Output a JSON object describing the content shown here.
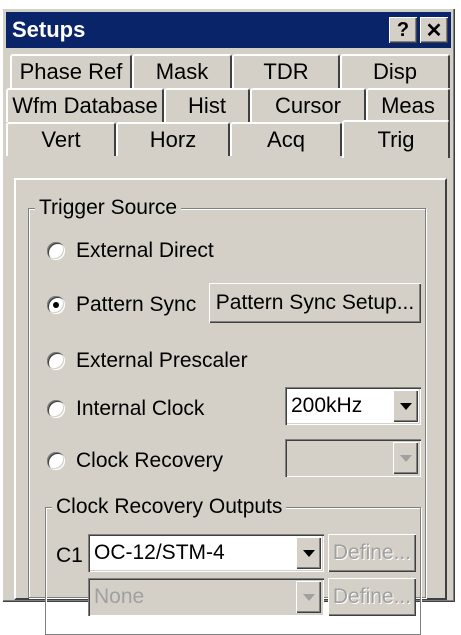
{
  "window": {
    "title": "Setups",
    "help_button": "?",
    "close_button": "✕"
  },
  "tabs": {
    "row1": [
      "Phase Ref",
      "Mask",
      "TDR",
      "Disp"
    ],
    "row2": [
      "Wfm Database",
      "Hist",
      "Cursor",
      "Meas"
    ],
    "row3": [
      "Vert",
      "Horz",
      "Acq",
      "Trig"
    ],
    "active": "Trig"
  },
  "trigger_source": {
    "legend": "Trigger Source",
    "options": {
      "external_direct": "External Direct",
      "pattern_sync": "Pattern Sync",
      "external_prescaler": "External Prescaler",
      "internal_clock": "Internal Clock",
      "clock_recovery": "Clock Recovery"
    },
    "selected": "Pattern Sync",
    "pattern_sync_setup_button": "Pattern Sync Setup...",
    "internal_clock_value": "200kHz",
    "clock_recovery_value": ""
  },
  "clock_recovery_outputs": {
    "legend": "Clock Recovery Outputs",
    "c1_label": "C1",
    "c1_value": "OC-12/STM-4",
    "c1_define": "Define...",
    "c2_value": "None",
    "c2_define": "Define..."
  }
}
